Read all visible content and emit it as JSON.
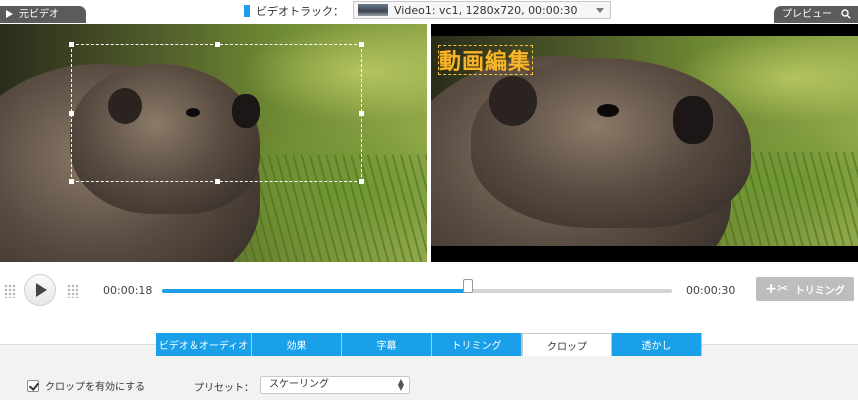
{
  "top": {
    "source_tab": "元ビデオ",
    "track_label": "ビデオトラック：",
    "track_value": "Video1: vc1, 1280x720, 00:00:30",
    "preview_tab": "プレビュー"
  },
  "preview": {
    "watermark_text": "動画編集"
  },
  "playback": {
    "current_time": "00:00:18",
    "end_time": "00:00:30",
    "progress": 0.6,
    "trim_label": "トリミング"
  },
  "tabs": [
    {
      "label": "ビデオ＆オーディオ"
    },
    {
      "label": "効果"
    },
    {
      "label": "字幕"
    },
    {
      "label": "トリミング"
    },
    {
      "label": "クロップ",
      "active": true
    },
    {
      "label": "透かし"
    }
  ],
  "crop": {
    "enable_label": "クロップを有効にする",
    "enabled": true,
    "preset_label": "プリセット：",
    "preset_value": "スケーリング"
  },
  "colors": {
    "accent": "#1aa0e8",
    "watermark": "#f7b52a",
    "tab_bar_dark": "#5b5b5b"
  },
  "icons": [
    "play-icon",
    "scissors-icon",
    "checkbox-icon",
    "dropdown-arrow-icon",
    "search-icon",
    "grip-icon"
  ]
}
